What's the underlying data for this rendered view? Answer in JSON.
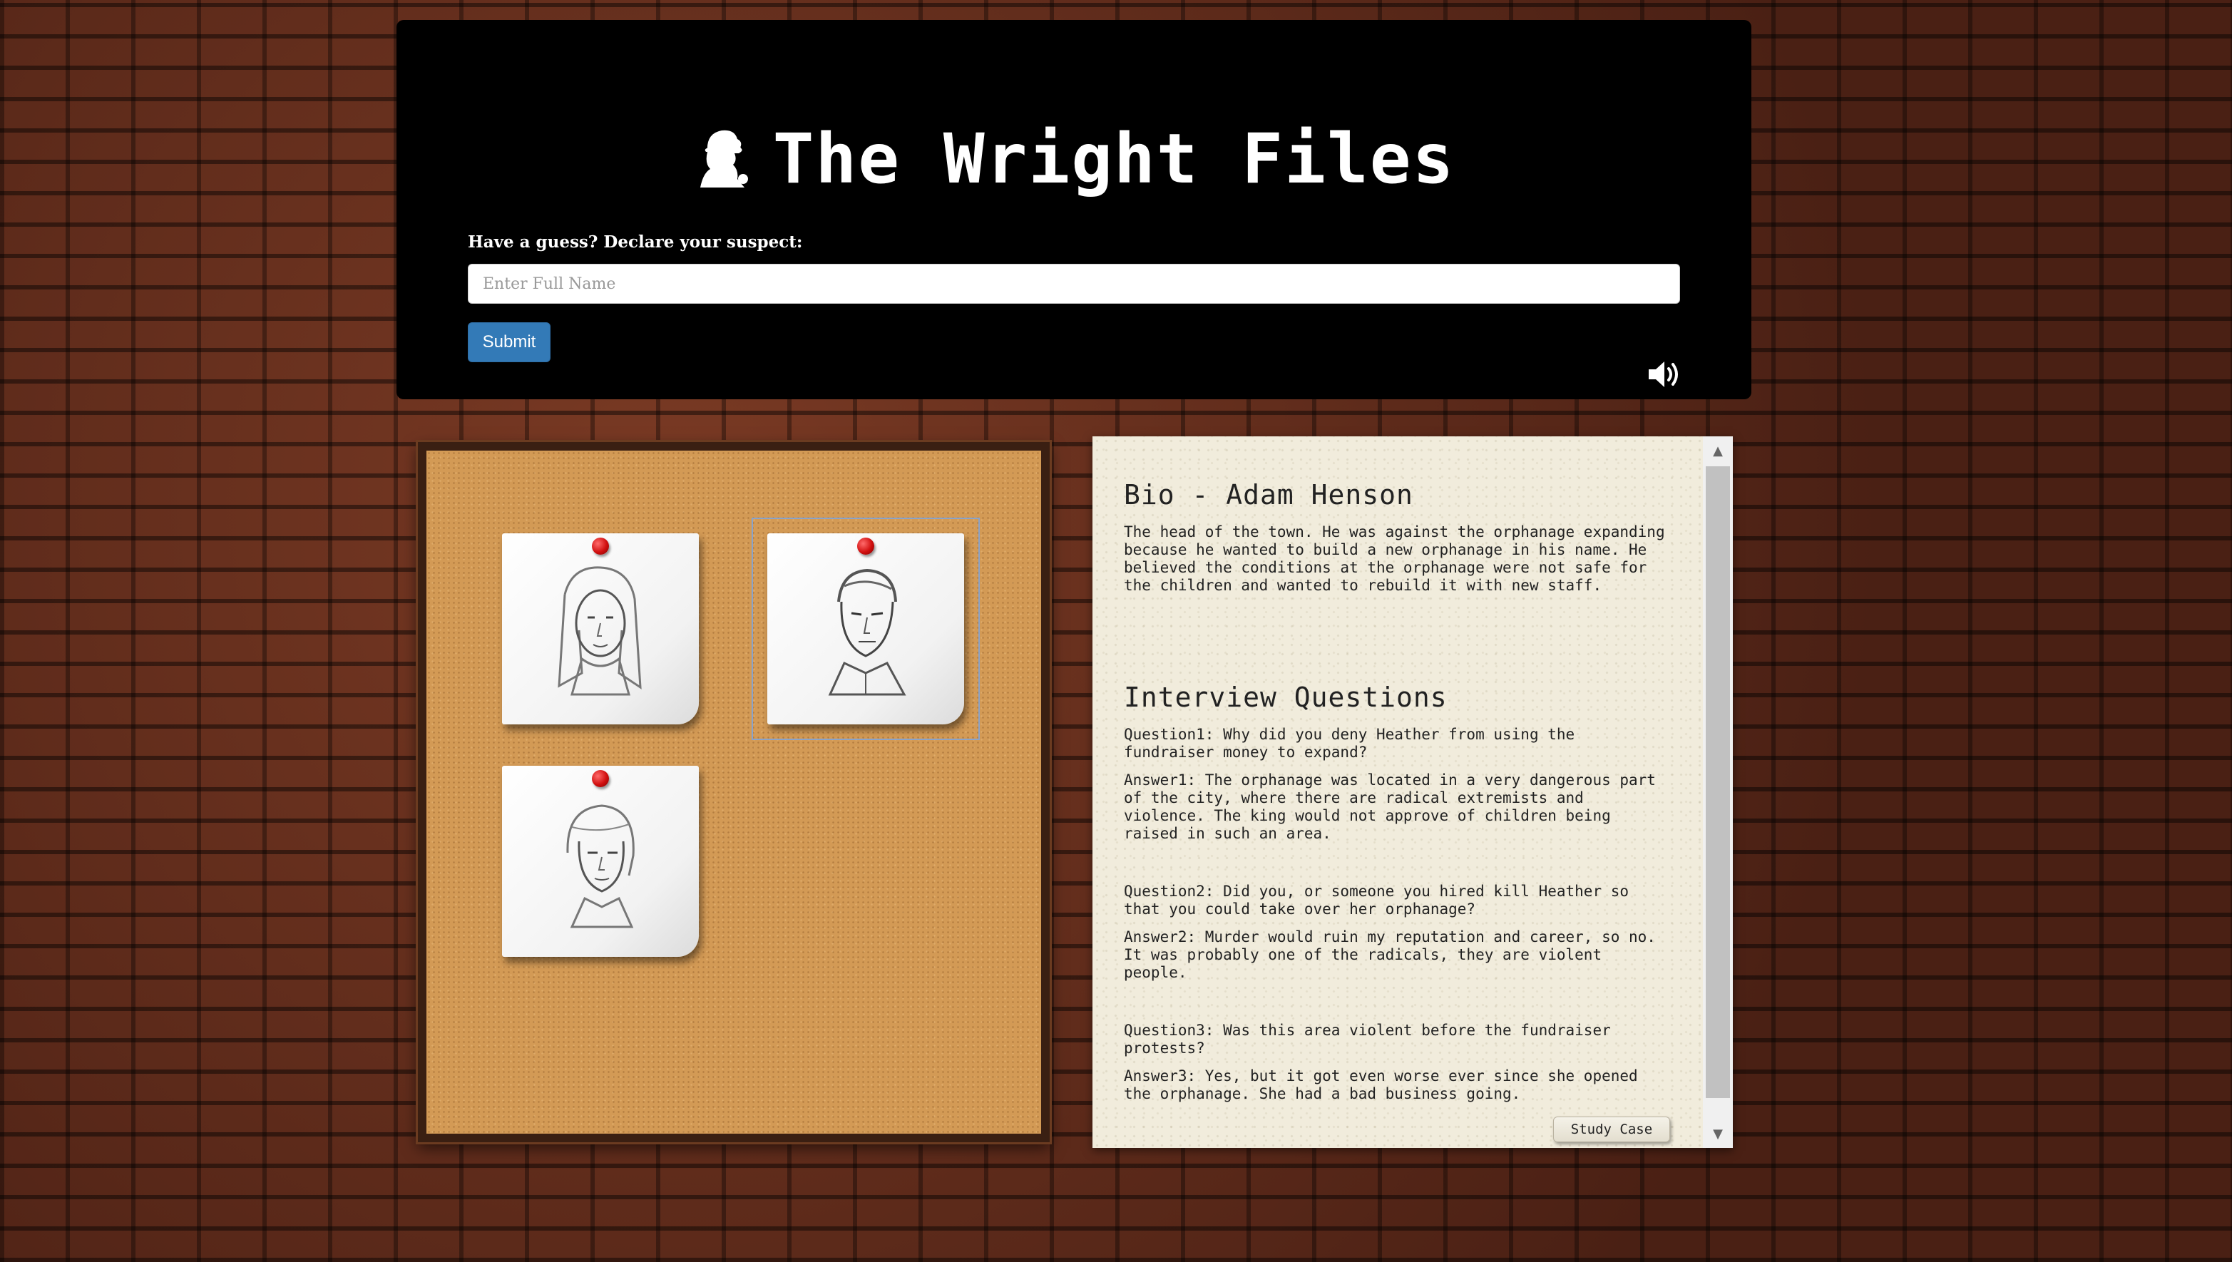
{
  "header": {
    "title": "The Wright Files",
    "logo_icon": "detective-silhouette-icon",
    "guess_label": "Have a guess? Declare your suspect:",
    "guess_placeholder": "Enter Full Name",
    "guess_value": "",
    "submit_label": "Submit",
    "sound_icon": "volume-icon",
    "submit_color": "#337ab7"
  },
  "corkboard": {
    "suspects": [
      {
        "name": "suspect-card-woman-long-hair",
        "selected": false
      },
      {
        "name": "suspect-card-man-uniform",
        "selected": true
      },
      {
        "name": "suspect-card-woman-short-hair",
        "selected": false
      }
    ]
  },
  "panel": {
    "bio_title": "Bio - Adam Henson",
    "bio_text": "The head of the town. He was against the orphanage expanding because he wanted to build a new orphanage in his name. He believed the conditions at the orphanage were not safe for the children and wanted to rebuild it with new staff.",
    "interview_title": "Interview Questions",
    "qa": [
      {
        "q": "Question1: Why did you deny Heather from using the fundraiser money to expand?",
        "a": "Answer1: The orphanage was located in a very dangerous part of the city, where there are radical extremists and violence. The king would not approve of children being raised in such an area."
      },
      {
        "q": "Question2: Did you, or someone you hired kill Heather so that you could take over her orphanage?",
        "a": "Answer2: Murder would ruin my reputation and career, so no. It was probably one of the radicals, they are violent people."
      },
      {
        "q": "Question3: Was this area violent before the fundraiser protests?",
        "a": "Answer3: Yes, but it got even worse ever since she opened the orphanage. She had a bad business going."
      }
    ],
    "study_button": "Study Case"
  }
}
